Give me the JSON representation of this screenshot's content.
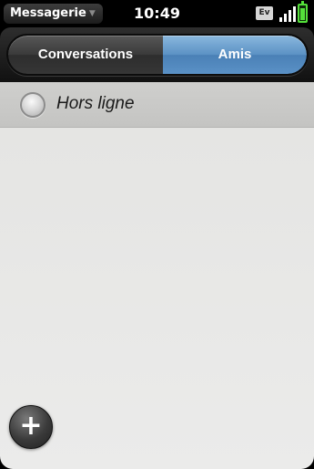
{
  "status_bar": {
    "app_menu": "Messagerie",
    "time": "10:49",
    "network_badge": "Ev",
    "signal_icon": "signal-bars-icon",
    "battery_icon": "battery-icon"
  },
  "tabs": [
    {
      "label": "Conversations",
      "selected": false
    },
    {
      "label": "Amis",
      "selected": true
    }
  ],
  "list": {
    "groups": [
      {
        "label": "Hors ligne",
        "status_icon": "offline-status-icon"
      }
    ]
  },
  "add_button": {
    "icon": "plus-icon",
    "glyph": "+"
  },
  "colors": {
    "selected_tab": "#5b91c4",
    "content_background": "#e8e8e6",
    "battery": "#54e03a"
  }
}
